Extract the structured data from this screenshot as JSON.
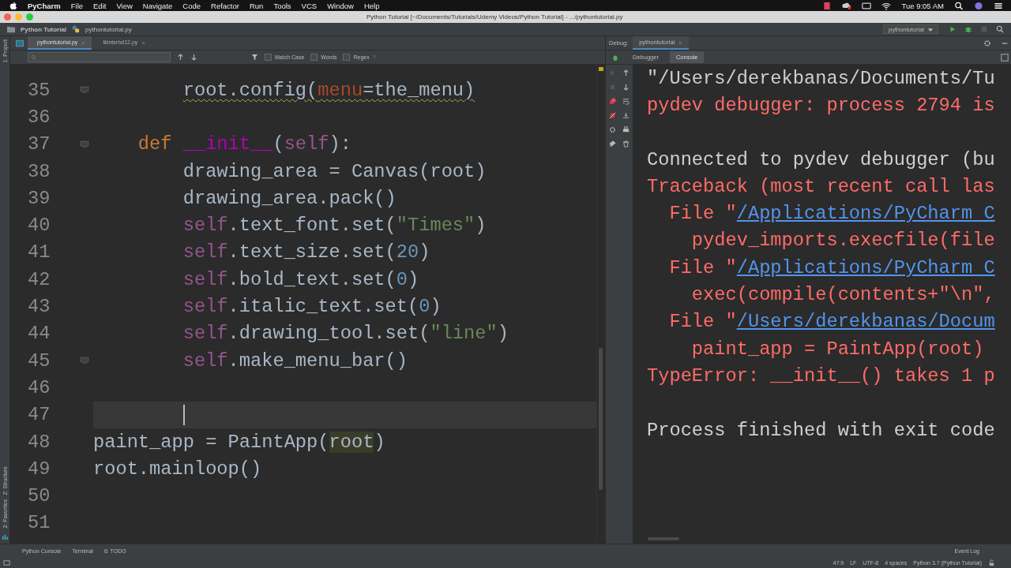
{
  "menu_bar": {
    "app": "PyCharm",
    "items": [
      "File",
      "Edit",
      "View",
      "Navigate",
      "Code",
      "Refactor",
      "Run",
      "Tools",
      "VCS",
      "Window",
      "Help"
    ],
    "clock": "Tue 9:05 AM"
  },
  "window": {
    "title": "Python Tutorial [~/Documents/Tutorials/Udemy Videos/Python Tutorial] - .../pythontutorial.py"
  },
  "nav": {
    "breadcrumbs": [
      "Python Tutorial",
      "pythontutorial.py"
    ],
    "run_config": "pythontutorial"
  },
  "editor_tabs": [
    {
      "label": "pythontutorial.py",
      "selected": true
    },
    {
      "label": "tkintertut12.py",
      "selected": false
    }
  ],
  "find_bar": {
    "options": [
      {
        "label": "Match Case",
        "checked": false
      },
      {
        "label": "Words",
        "checked": false
      },
      {
        "label": "Regex",
        "checked": false
      }
    ],
    "help": "?"
  },
  "editor": {
    "lines": [
      {
        "number": "35",
        "kind": "body",
        "fold": true,
        "warning": true,
        "current": false,
        "tokens": [
          {
            "text": "root.config(",
            "kind": "plain"
          },
          {
            "text": "menu",
            "kind": "param"
          },
          {
            "text": "=the_menu)",
            "kind": "plain"
          }
        ]
      },
      {
        "number": "36",
        "fold": false,
        "current": false
      },
      {
        "number": "37",
        "kind": "method",
        "fold": true,
        "warning": false,
        "current": false,
        "tokens": [
          {
            "text": "def ",
            "kind": "keyword"
          },
          {
            "text": "__init__",
            "kind": "magic"
          },
          {
            "text": "(",
            "kind": "plain"
          },
          {
            "text": "self",
            "kind": "self"
          },
          {
            "text": "):",
            "kind": "plain"
          }
        ]
      },
      {
        "number": "38",
        "kind": "body",
        "fold": false,
        "warning": false,
        "current": false,
        "tokens": [
          {
            "text": "drawing_area = Canvas(root)",
            "kind": "plain"
          }
        ]
      },
      {
        "number": "39",
        "kind": "body",
        "fold": false,
        "warning": false,
        "current": false,
        "tokens": [
          {
            "text": "drawing_area.pack()",
            "kind": "plain"
          }
        ]
      },
      {
        "number": "40",
        "kind": "body",
        "fold": false,
        "warning": false,
        "current": false,
        "tokens": [
          {
            "text": "self",
            "kind": "self"
          },
          {
            "text": ".text_font.set(",
            "kind": "plain"
          },
          {
            "text": "\"Times\"",
            "kind": "string"
          },
          {
            "text": ")",
            "kind": "plain"
          }
        ]
      },
      {
        "number": "41",
        "kind": "body",
        "fold": false,
        "warning": false,
        "current": false,
        "tokens": [
          {
            "text": "self",
            "kind": "self"
          },
          {
            "text": ".text_size.set(",
            "kind": "plain"
          },
          {
            "text": "20",
            "kind": "number"
          },
          {
            "text": ")",
            "kind": "plain"
          }
        ]
      },
      {
        "number": "42",
        "kind": "body",
        "fold": false,
        "warning": false,
        "current": false,
        "tokens": [
          {
            "text": "self",
            "kind": "self"
          },
          {
            "text": ".bold_text.set(",
            "kind": "plain"
          },
          {
            "text": "0",
            "kind": "number"
          },
          {
            "text": ")",
            "kind": "plain"
          }
        ]
      },
      {
        "number": "43",
        "kind": "body",
        "fold": false,
        "warning": false,
        "current": false,
        "tokens": [
          {
            "text": "self",
            "kind": "self"
          },
          {
            "text": ".italic_text.set(",
            "kind": "plain"
          },
          {
            "text": "0",
            "kind": "number"
          },
          {
            "text": ")",
            "kind": "plain"
          }
        ]
      },
      {
        "number": "44",
        "kind": "body",
        "fold": false,
        "warning": false,
        "current": false,
        "tokens": [
          {
            "text": "self",
            "kind": "self"
          },
          {
            "text": ".drawing_tool.set(",
            "kind": "plain"
          },
          {
            "text": "\"line\"",
            "kind": "string"
          },
          {
            "text": ")",
            "kind": "plain"
          }
        ]
      },
      {
        "number": "45",
        "kind": "body",
        "fold": true,
        "warning": false,
        "current": false,
        "tokens": [
          {
            "text": "self",
            "kind": "self"
          },
          {
            "text": ".make_menu_bar()",
            "kind": "plain"
          }
        ]
      },
      {
        "number": "46",
        "fold": false,
        "current": false
      },
      {
        "number": "47",
        "kind": "body",
        "fold": false,
        "current": true
      },
      {
        "number": "48",
        "kind": "top",
        "fold": false,
        "warning": false,
        "current": false,
        "tokens": [
          {
            "text": "paint_app = PaintApp(",
            "kind": "plain"
          },
          {
            "text": "root",
            "kind": "usage"
          },
          {
            "text": ")",
            "kind": "plain"
          }
        ]
      },
      {
        "number": "49",
        "kind": "top",
        "fold": false,
        "warning": false,
        "current": false,
        "tokens": [
          {
            "text": "root.mainloop()",
            "kind": "plain"
          }
        ]
      },
      {
        "number": "50",
        "fold": false,
        "current": false
      },
      {
        "number": "51",
        "fold": false,
        "current": false
      }
    ]
  },
  "debug": {
    "label": "Debug:",
    "tab": "pythontutorial",
    "subtabs": [
      {
        "label": "Debugger",
        "selected": false
      },
      {
        "label": "Console",
        "selected": true
      }
    ],
    "console": [
      {
        "kind": "output",
        "segments": [
          {
            "text": "\"/Users/derekbanas/Documents/Tu",
            "kind": "text"
          }
        ]
      },
      {
        "kind": "output",
        "segments": [
          {
            "text": "pydev debugger: process 2794 is",
            "kind": "error"
          }
        ]
      },
      {
        "kind": "blank"
      },
      {
        "kind": "output",
        "segments": [
          {
            "text": "Connected to pydev debugger (bu",
            "kind": "text"
          }
        ]
      },
      {
        "kind": "output",
        "segments": [
          {
            "text": "Traceback (most recent call las",
            "kind": "error"
          }
        ]
      },
      {
        "kind": "output",
        "segments": [
          {
            "text": "File \"",
            "kind": "error"
          },
          {
            "text": "/Applications/PyCharm C",
            "kind": "link"
          }
        ]
      },
      {
        "kind": "detail",
        "segments": [
          {
            "text": "pydev_imports.execfile(file",
            "kind": "error"
          }
        ]
      },
      {
        "kind": "output",
        "segments": [
          {
            "text": "File \"",
            "kind": "error"
          },
          {
            "text": "/Applications/PyCharm C",
            "kind": "link"
          }
        ]
      },
      {
        "kind": "detail",
        "segments": [
          {
            "text": "exec(compile(contents+\"\\n\",",
            "kind": "error"
          }
        ]
      },
      {
        "kind": "output",
        "segments": [
          {
            "text": "File \"",
            "kind": "error"
          },
          {
            "text": "/Users/derekbanas/Docum",
            "kind": "link"
          }
        ]
      },
      {
        "kind": "detail",
        "segments": [
          {
            "text": "paint_app = PaintApp(root)",
            "kind": "error"
          }
        ]
      },
      {
        "kind": "output",
        "segments": [
          {
            "text": "TypeError: __init__() takes 1 p",
            "kind": "error"
          }
        ]
      },
      {
        "kind": "blank"
      },
      {
        "kind": "output",
        "segments": [
          {
            "text": "Process finished with exit code",
            "kind": "text"
          }
        ]
      }
    ]
  },
  "tool_windows": {
    "left": [
      "1: Project",
      "Z: Structure",
      "2: Favorites"
    ],
    "bottom": [
      "Python Console",
      "Terminal",
      "6: TODO"
    ]
  },
  "status_bar": {
    "items": [
      "47:9",
      "LF",
      "UTF-8",
      "4 spaces",
      "Python 3.7 (Python Tutorial)"
    ],
    "event_log": "Event Log"
  }
}
